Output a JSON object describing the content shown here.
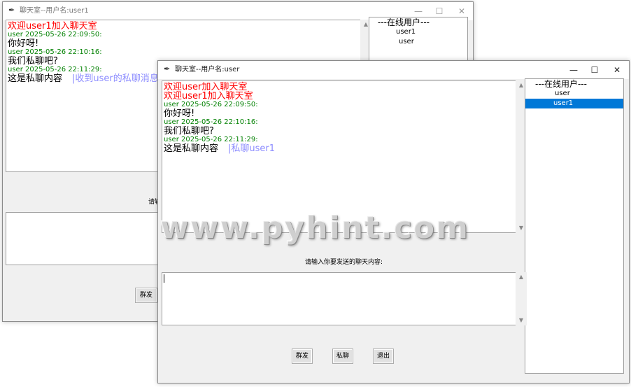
{
  "back_window": {
    "title": "聊天室--用户名:user1",
    "icon": "feather-icon",
    "controls": {
      "minimize": "—",
      "maximize": "☐",
      "close": "✕"
    },
    "messages": [
      {
        "type": "sys",
        "text": "欢迎user1加入聊天室"
      },
      {
        "type": "meta",
        "text": "user 2025-05-26 22:09:50:"
      },
      {
        "type": "text",
        "text": "你好呀!"
      },
      {
        "type": "meta",
        "text": "user 2025-05-26 22:10:16:"
      },
      {
        "type": "text",
        "text": "我们私聊吧?"
      },
      {
        "type": "meta",
        "text": "user 2025-05-26 22:11:29:"
      },
      {
        "type": "text",
        "text": "这是私聊内容",
        "note": "|收到user的私聊消息"
      }
    ],
    "online_header": "---在线用户---",
    "users": [
      "user1",
      "user"
    ],
    "prompt_partial": "请输",
    "buttons": {
      "group": "群发"
    }
  },
  "front_window": {
    "title": "聊天室--用户名:user",
    "icon": "feather-icon",
    "controls": {
      "minimize": "—",
      "maximize": "☐",
      "close": "✕"
    },
    "messages": [
      {
        "type": "sys",
        "text": "欢迎user加入聊天室"
      },
      {
        "type": "sys",
        "text": "欢迎user1加入聊天室"
      },
      {
        "type": "meta",
        "text": "user 2025-05-26 22:09:50:"
      },
      {
        "type": "text",
        "text": "你好呀!"
      },
      {
        "type": "meta",
        "text": "user 2025-05-26 22:10:16:"
      },
      {
        "type": "text",
        "text": "我们私聊吧?"
      },
      {
        "type": "meta",
        "text": "user 2025-05-26 22:11:29:"
      },
      {
        "type": "text",
        "text": "这是私聊内容",
        "note": "|私聊user1"
      }
    ],
    "online_header": "---在线用户---",
    "users": [
      "user",
      "user1"
    ],
    "selected_user": "user1",
    "prompt": "请输入你要发送的聊天内容:",
    "input_value": "",
    "buttons": {
      "group": "群发",
      "private": "私聊",
      "exit": "退出"
    }
  },
  "watermark": "www.pyhint.com",
  "colors": {
    "system": "#ff0000",
    "meta": "#008000",
    "note": "#8c8cff",
    "selection": "#0078d7"
  }
}
